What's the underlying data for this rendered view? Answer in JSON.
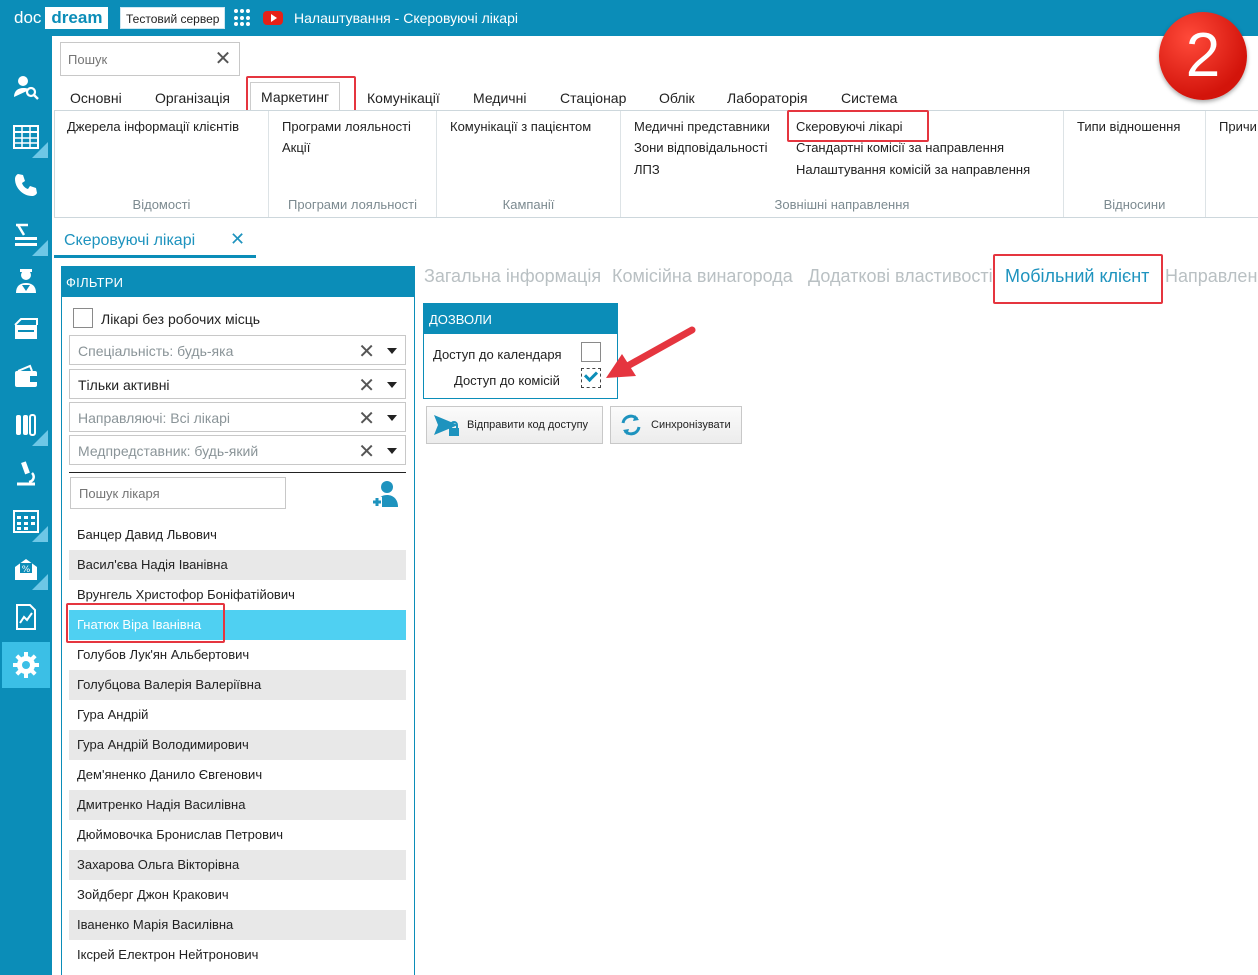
{
  "titlebar": {
    "logo_doc": "doc",
    "logo_dream": "dream",
    "server": "Тестовий сервер",
    "title": "Налаштування - Скеровуючі лікарі"
  },
  "search": {
    "placeholder": "Пошук",
    "clear": "✕"
  },
  "badge": "2",
  "tabs": [
    "Основні",
    "Організація",
    "Маркетинг",
    "Комунікації",
    "Медичні",
    "Стаціонар",
    "Облік",
    "Лабораторія",
    "Система"
  ],
  "ribbon": {
    "groups": [
      {
        "title": "Відомості",
        "links": [
          "Джерела інформації клієнтів"
        ]
      },
      {
        "title": "Програми лояльності",
        "links": [
          "Програми лояльності",
          "Акції"
        ]
      },
      {
        "title": "Кампанії",
        "links": [
          "Комунікації з пацієнтом"
        ]
      },
      {
        "title": "Зовнішні направлення",
        "links": [
          "Медичні представники",
          "Зони відповідальності",
          "ЛПЗ",
          "Скеровуючі лікарі",
          "Стандартні комісії за направлення",
          "Налаштування комісій за направлення"
        ]
      },
      {
        "title": "Відносини",
        "links": [
          "Типи відношення"
        ]
      },
      {
        "title": "",
        "links": [
          "Причи"
        ]
      }
    ]
  },
  "doc_tab": {
    "label": "Скеровуючі лікарі",
    "close": "✕"
  },
  "filters": {
    "header": "ФІЛЬТРИ",
    "no_workplace": "Лікарі без робочих місць",
    "combos": [
      "Спеціальність: будь-яка",
      "Тільки активні",
      "Направляючі: Всі лікарі",
      "Медпредставник: будь-який"
    ],
    "clear": "✕",
    "doctor_search_placeholder": "Пошук лікаря"
  },
  "doctors": [
    "Банцер Давид Львович",
    "Васил'єва Надія Іванівна",
    "Врунгель Христофор Боніфатійович",
    "Гнатюк Віра Іванівна",
    "Голубов Лук'ян Альбертович",
    "Голубцова Валерія Валеріївна",
    "Гура Андрій",
    "Гура Андрій Володимирович",
    "Дем'яненко Данило Євгенович",
    "Дмитренко Надія Василівна",
    "Дюймовочка Бронислав Петрович",
    "Захарова Ольга Вікторівна",
    "Зойдберг Джон Кракович",
    "Іваненко Марія Василівна",
    "Іксрей Електрон Нейтронович"
  ],
  "selected_doctor": "Гнатюк Віра Іванівна",
  "content_tabs": [
    "Загальна інформація",
    "Комісійна винагорода",
    "Додаткові властивості",
    "Мобільний клієнт",
    "Направлен"
  ],
  "permissions": {
    "header": "ДОЗВОЛИ",
    "calendar_access": "Доступ до календаря",
    "commission_access": "Доступ до комісій",
    "calendar_checked": false,
    "commission_checked": true
  },
  "buttons": {
    "send_code": "Відправити код доступу",
    "sync": "Синхронізувати"
  },
  "colors": {
    "brand": "#0b8db8",
    "selected_row": "#4fd0f2",
    "highlight": "#e5353f",
    "badge": "#e01a10"
  }
}
